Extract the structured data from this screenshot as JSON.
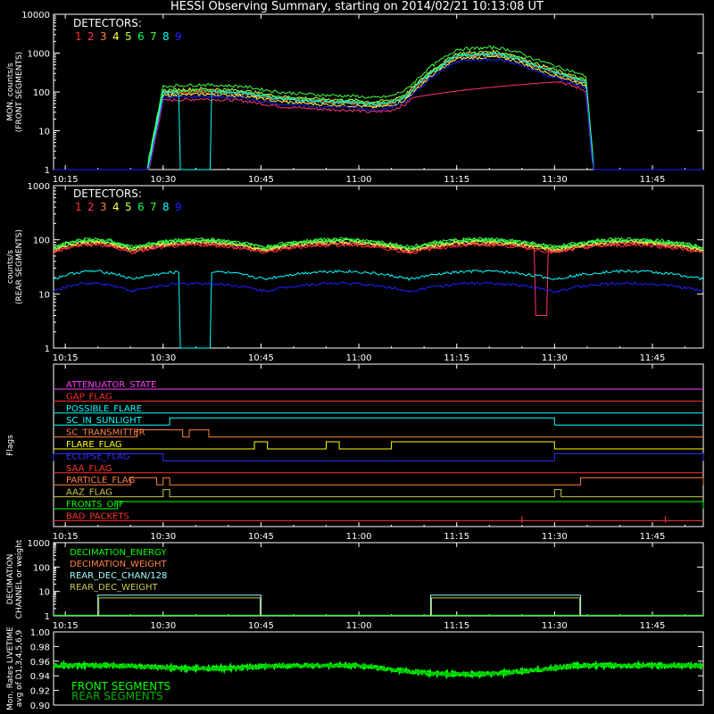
{
  "page_title": "HESSI Observing Summary, starting on 2014/02/21 10:13:08 UT",
  "colors": {
    "bg": "#000000",
    "axis": "#ffffff",
    "det": [
      "#ff3030",
      "#ff3366",
      "#ff8040",
      "#ffff40",
      "#c0ff40",
      "#00ff66",
      "#40ff40",
      "#00ffff",
      "#2020ff"
    ],
    "magenta": "#ff40ff",
    "red": "#ff3030",
    "cyan": "#00ffff",
    "orange": "#ff8040",
    "yellow": "#ffff00",
    "blue": "#3030ff",
    "green": "#00ff00",
    "olive": "#c8c850",
    "pink": "#ff3399"
  },
  "chart_data": [
    {
      "type": "line",
      "name": "front",
      "ylabel": "MON. counts/s\n(FRONT SEGMENTS)",
      "yscale": "log",
      "ylim": [
        1,
        10000
      ],
      "y_ticks": [
        "1",
        "10",
        "100",
        "1000",
        "10000"
      ],
      "x_ticks": [
        "10:15",
        "10:30",
        "10:45",
        "11:00",
        "11:15",
        "11:30",
        "11:45"
      ],
      "legend_title": "DETECTORS:",
      "legend_items": [
        "1",
        "2",
        "3",
        "4",
        "5",
        "6",
        "7",
        "8",
        "9"
      ],
      "series_profile": {
        "t": [
          10.22,
          10.46,
          10.5,
          10.6,
          10.7,
          10.8,
          10.9,
          11.0,
          11.03,
          11.08,
          11.12,
          11.18,
          11.25,
          11.35,
          11.4,
          11.45,
          11.54,
          11.58,
          11.6
        ],
        "y": [
          1,
          1,
          100,
          110,
          100,
          70,
          60,
          55,
          50,
          55,
          80,
          300,
          900,
          1000,
          800,
          500,
          250,
          180,
          1
        ]
      },
      "series_scale": [
        1.0,
        0.6,
        0.9,
        0.8,
        1.1,
        1.0,
        1.4,
        0.95,
        0.7
      ]
    },
    {
      "type": "line",
      "name": "rear",
      "ylabel": "counts/s\n(REAR SEGMENTS)",
      "yscale": "log",
      "ylim": [
        1,
        1000
      ],
      "y_ticks": [
        "1",
        "10",
        "100",
        "1000"
      ],
      "x_ticks": [
        "10:15",
        "10:30",
        "10:45",
        "11:00",
        "11:15",
        "11:30",
        "11:45"
      ],
      "legend_title": "DETECTORS:",
      "legend_items": [
        "1",
        "2",
        "3",
        "4",
        "5",
        "6",
        "7",
        "8",
        "9"
      ],
      "typical_levels": {
        "main": 90,
        "cyan": 25,
        "blue": 15
      }
    },
    {
      "type": "step",
      "name": "flags",
      "ylabel": "Flags",
      "x_ticks": [
        "10:15",
        "10:30",
        "10:45",
        "11:00",
        "11:15",
        "11:30",
        "11:45"
      ],
      "flags": [
        "ATTENUATOR_STATE",
        "GAP_FLAG",
        "POSSIBLE_FLARE",
        "SC_IN_SUNLIGHT",
        "SC_TRANSMITTER",
        "FLARE_FLAG",
        "ECLIPSE_FLAG",
        "SAA_FLAG",
        "PARTICLE_FLAG",
        "AAZ_FLAG",
        "FRONTS_OFF",
        "BAD_PACKETS"
      ]
    },
    {
      "type": "step",
      "name": "decimation",
      "ylabel": "DECIMATION\nCHANNEL or weight",
      "yscale": "log",
      "ylim": [
        1,
        1000
      ],
      "y_ticks": [
        "1",
        "10",
        "100",
        "1000"
      ],
      "x_ticks": [
        "10:15",
        "10:30",
        "10:45",
        "11:00",
        "11:15",
        "11:30",
        "11:45"
      ],
      "legend": [
        "DECIMATION_ENERGY",
        "DECIMATION_WEIGHT",
        "REAR_DEC_CHAN/128",
        "REAR_DEC_WEIGHT"
      ]
    },
    {
      "type": "line",
      "name": "livetime",
      "ylabel": "Mon. Rates LIVETIME\navg of D1,3,4,5,6,9",
      "ylim": [
        0.9,
        1.0
      ],
      "y_ticks": [
        "0.90",
        "0.92",
        "0.94",
        "0.96",
        "0.98",
        "1.00"
      ],
      "legend": [
        "FRONT SEGMENTS",
        "REAR SEGMENTS"
      ]
    }
  ]
}
